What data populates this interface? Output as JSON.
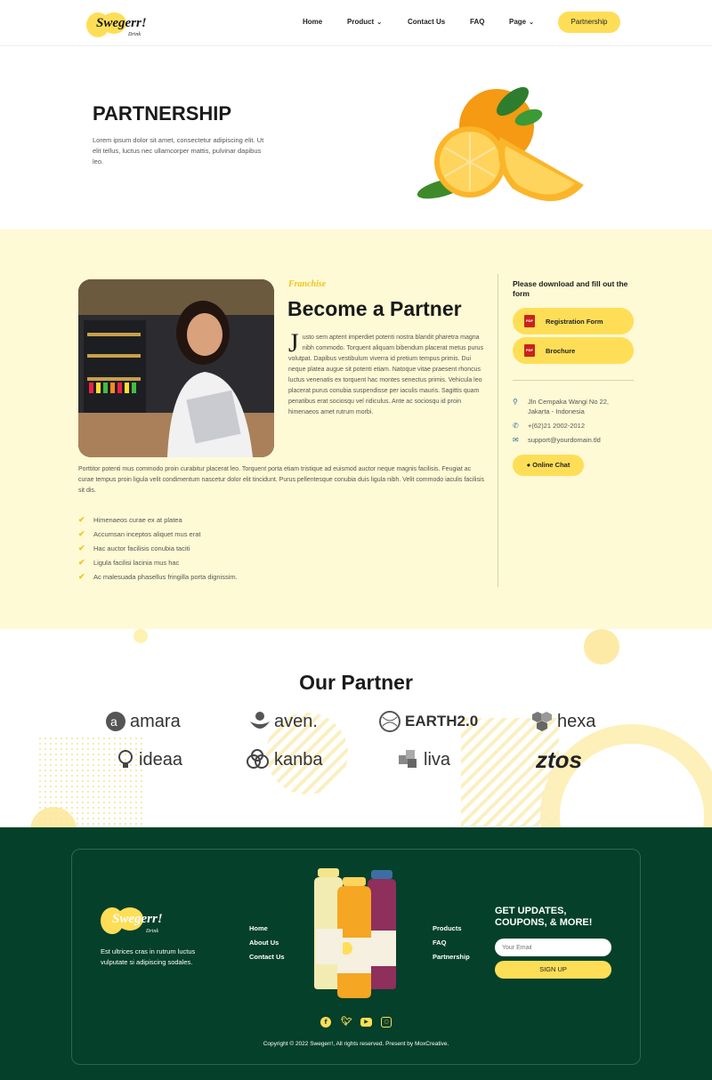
{
  "header": {
    "logo_text": "Swegerr!",
    "logo_sub": "Drink",
    "nav": [
      {
        "label": "Home"
      },
      {
        "label": "Product"
      },
      {
        "label": "Contact Us"
      },
      {
        "label": "FAQ"
      },
      {
        "label": "Page"
      }
    ],
    "cta_label": "Partnership"
  },
  "hero": {
    "title": "PARTNERSHIP",
    "text": "Lorem ipsum dolor sit amet, consectetur adipiscing elit. Ut elit tellus, luctus nec ullamcorper mattis, pulvinar dapibus leo."
  },
  "partner": {
    "eyebrow": "Franchise",
    "title": "Become a Partner",
    "dropcap": "J",
    "body1": "usto sem aptent imperdiet potenti nostra blandit pharetra magna nibh commodo. Torquent aliquam bibendum placerat metus purus volutpat. Dapibus vestibulum viverra id pretium tempus primis. Dui neque platea augue sit potenti etiam. Natoque vitae praesent rhoncus luctus venenatis ex torquent hac montes senectus primis. Vehicula leo placerat purus conubia suspendisse per iaculis mauris. Sagittis quam penatibus erat sociosqu vel ridiculus. Ante ac sociosqu id proin himenaeos amet rutrum morbi.",
    "body2": "Porttitor potenti mus commodo proin curabitur placerat leo. Torquent porta etiam tristique ad euismod auctor neque magnis facilisis. Feugiat ac curae tempus proin ligula velit condimentum nascetur dolor elit tincidunt. Purus pellentesque conubia duis ligula nibh. Velit commodo iaculis facilisis sit dis.",
    "checklist": [
      "Himenaeos curae ex at platea",
      "Accumsan inceptos aliquet mus erat",
      "Hac auctor facilisis conubia taciti",
      "Ligula facilisi lacinia mus hac",
      "Ac malesuada phasellus fringilla porta dignissim."
    ]
  },
  "sidebar": {
    "download_title": "Please download and fill out the form",
    "buttons": [
      {
        "label": "Registration Form",
        "icon": "pdf-icon"
      },
      {
        "label": "Brochure",
        "icon": "pdf-icon"
      }
    ],
    "address": "Jln Cempaka Wangi No 22, Jakarta - Indonesia",
    "phone": "+(62)21 2002-2012",
    "email": "support@yourdomain.tld",
    "chat_label": "Online Chat"
  },
  "our_partner": {
    "title": "Our Partner",
    "logos": [
      "amara",
      "aven.",
      "EARTH2.0",
      "hexa",
      "ideaa",
      "kanba",
      "liva",
      "ztos"
    ]
  },
  "footer": {
    "logo_text": "Swegerr!",
    "logo_sub": "Drink",
    "text": "Est ultrices cras in rutrum luctus vulputate si adipiscing sodales.",
    "links_left": [
      "Home",
      "About Us",
      "Contact Us"
    ],
    "links_right": [
      "Products",
      "FAQ",
      "Partnership"
    ],
    "updates_title": "GET UPDATES, COUPONS, & MORE!",
    "email_placeholder": "Your Email",
    "signup_label": "SIGN UP",
    "social": [
      "facebook-icon",
      "twitter-icon",
      "youtube-icon",
      "instagram-icon"
    ],
    "copyright": "Copyright © 2022 Swegerr!, All rights reserved. Present by MoxCreative."
  },
  "colors": {
    "accent": "#ffde57",
    "cream": "#fefad5",
    "footer_bg": "#05402a"
  }
}
